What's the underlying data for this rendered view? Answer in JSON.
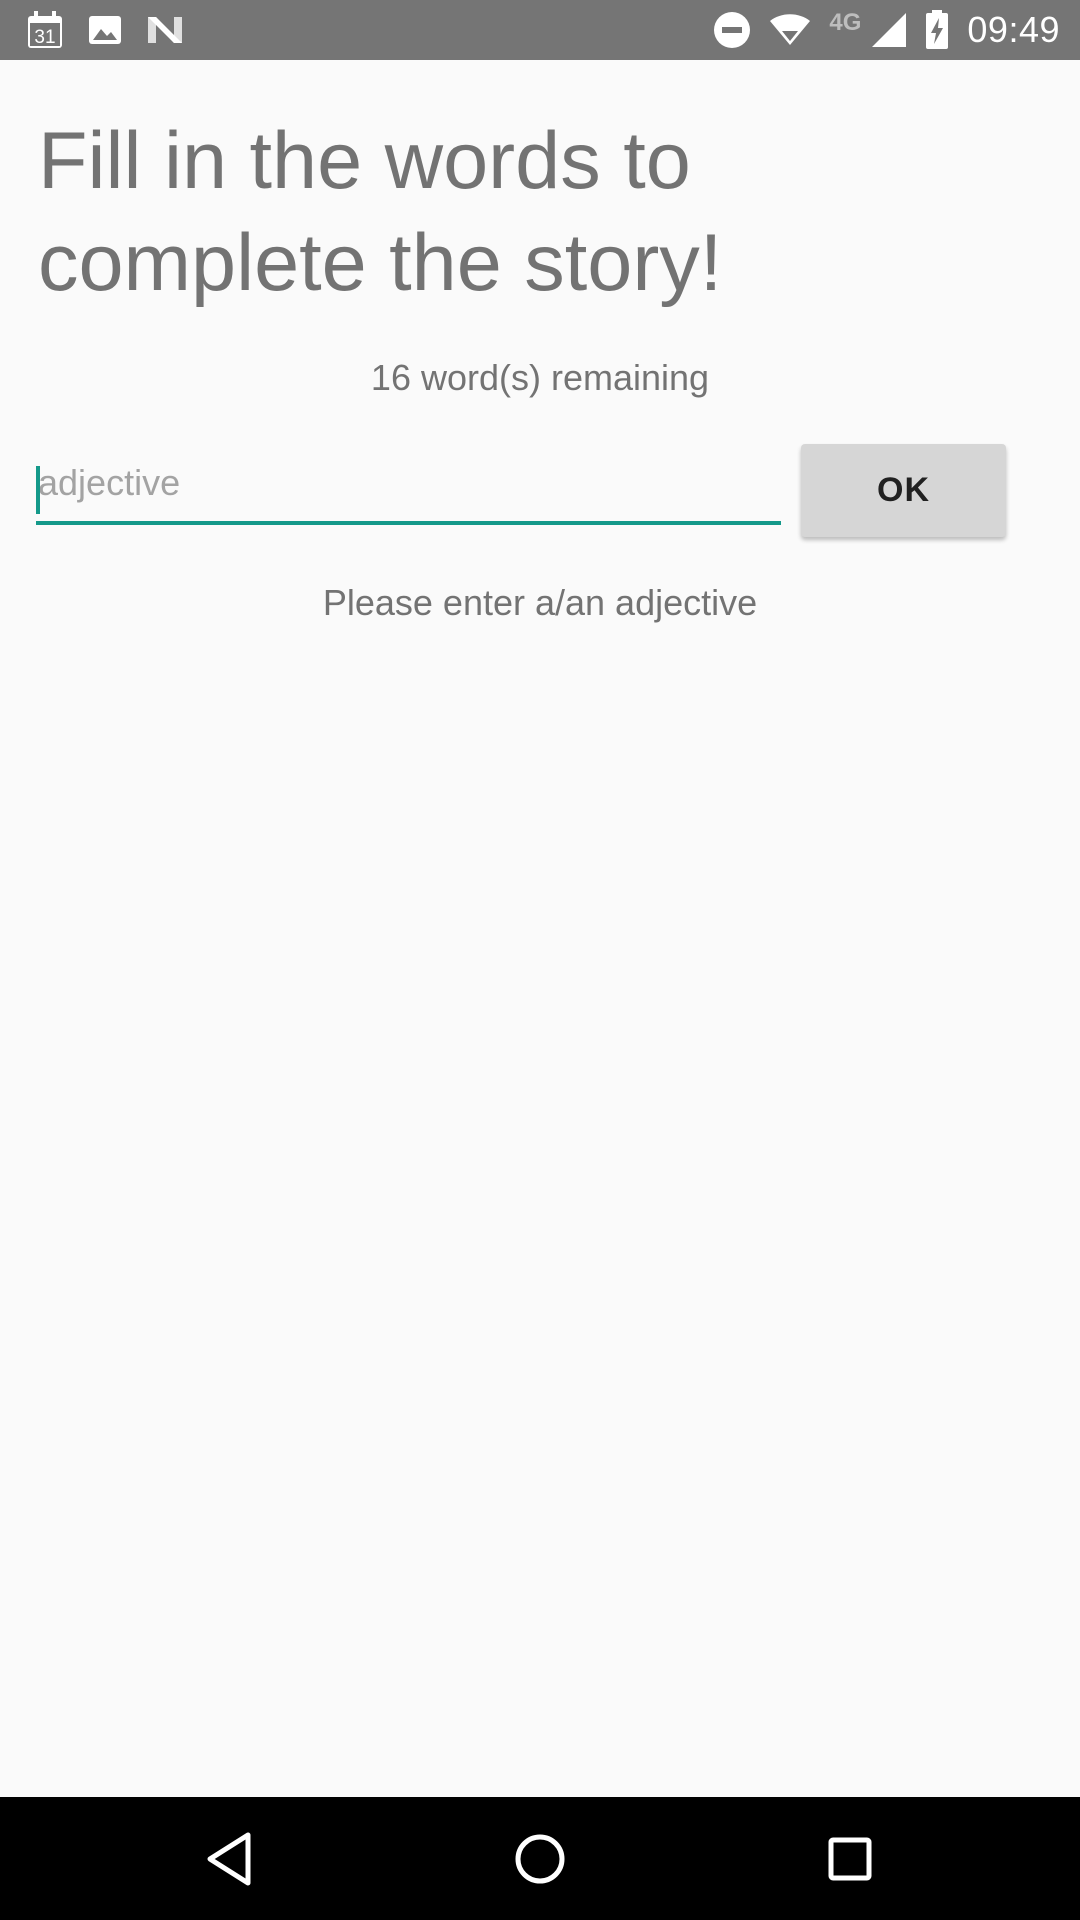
{
  "status_bar": {
    "time": "09:49",
    "network_type": "4G",
    "calendar_day": "31",
    "background_color": "#757575",
    "left_icons": [
      "calendar-icon",
      "image-icon",
      "n-logo-icon"
    ],
    "right_icons": [
      "do-not-disturb-icon",
      "wifi-icon",
      "cell-signal-icon",
      "battery-charging-icon"
    ]
  },
  "main": {
    "title": "Fill in the words to complete the story!",
    "remaining_text": "16 word(s) remaining",
    "input": {
      "value": "",
      "placeholder": "adjective"
    },
    "ok_button_label": "OK",
    "prompt_text": "Please enter a/an adjective"
  },
  "nav_bar": {
    "buttons": [
      "back-icon",
      "home-icon",
      "recents-icon"
    ]
  },
  "colors": {
    "accent": "#14998a",
    "text_secondary": "#737373",
    "button_bg": "#d6d6d6",
    "background": "#fafafa"
  }
}
